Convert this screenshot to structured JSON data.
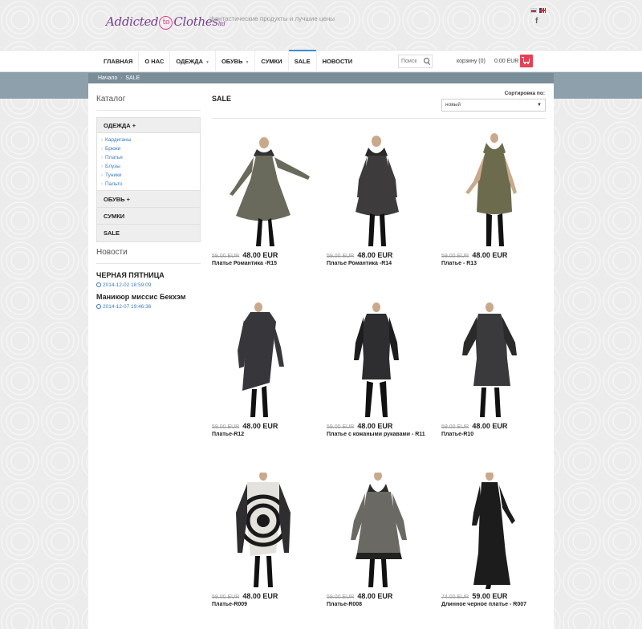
{
  "header": {
    "logo": {
      "part1": "Addicted",
      "to": "to",
      "part2": "Clothes",
      "suffix": "ltd"
    },
    "tagline": "фантастические продукты и лучшие цены",
    "social_icon": "f"
  },
  "nav": {
    "items": [
      {
        "label": "ГЛАВНАЯ",
        "has_dropdown": false
      },
      {
        "label": "О НАС",
        "has_dropdown": false
      },
      {
        "label": "ОДЕЖДА",
        "has_dropdown": true
      },
      {
        "label": "ОБУВЬ",
        "has_dropdown": true
      },
      {
        "label": "СУМКИ",
        "has_dropdown": false
      },
      {
        "label": "SALE",
        "has_dropdown": false,
        "active": true
      },
      {
        "label": "НОВОСТИ",
        "has_dropdown": false
      }
    ],
    "search": {
      "placeholder": "Поиск",
      "value": ""
    },
    "cart": {
      "label": "корзину (0)",
      "total": "0.00 EUR"
    }
  },
  "breadcrumb": {
    "home": "Начало",
    "current": "SALE"
  },
  "sidebar": {
    "catalog_title": "Каталог",
    "categories": [
      {
        "label": "ОДЕЖДА +",
        "subitems": [
          "Кардиганы",
          "Брюки",
          "Платья",
          "Блузы",
          "Туники",
          "Пальто"
        ]
      },
      {
        "label": "ОБУВЬ +"
      },
      {
        "label": "СУМКИ"
      },
      {
        "label": "SALE"
      }
    ],
    "news_title": "Новости",
    "news": [
      {
        "title": "ЧЕРНАЯ ПЯТНИЦА",
        "date": "2014-12-02 18:59:09"
      },
      {
        "title": "Маникюр миссис Бекхэм",
        "date": "2014-12-07 19:46:36"
      }
    ]
  },
  "main": {
    "title": "SALE",
    "sort_label": "Сортировка по:",
    "sort_value": "новый",
    "products": [
      {
        "old_price": "59.00 EUR",
        "price": "48.00 EUR",
        "name": "Платье Романтика -R15"
      },
      {
        "old_price": "59.00 EUR",
        "price": "48.00 EUR",
        "name": "Платье Романтика -R14"
      },
      {
        "old_price": "59.00 EUR",
        "price": "48.00 EUR",
        "name": "Платье - R13"
      },
      {
        "old_price": "59.00 EUR",
        "price": "48.00 EUR",
        "name": "Платье-R12"
      },
      {
        "old_price": "59.00 EUR",
        "price": "48.00 EUR",
        "name": "Платье с кожаными рукавами - R11"
      },
      {
        "old_price": "59.00 EUR",
        "price": "48.00 EUR",
        "name": "Платье-R10"
      },
      {
        "old_price": "59.00 EUR",
        "price": "48.00 EUR",
        "name": "Платье-R009"
      },
      {
        "old_price": "59.00 EUR",
        "price": "48.00 EUR",
        "name": "Платье-R008"
      },
      {
        "old_price": "74.00 EUR",
        "price": "59.00 EUR",
        "name": "Длинное черное платье - R007"
      }
    ]
  },
  "colors": {
    "accent_blue": "#3a8ed3",
    "cart_red": "#e44357",
    "band": "#8ea0ac",
    "link": "#3a7bbf"
  }
}
